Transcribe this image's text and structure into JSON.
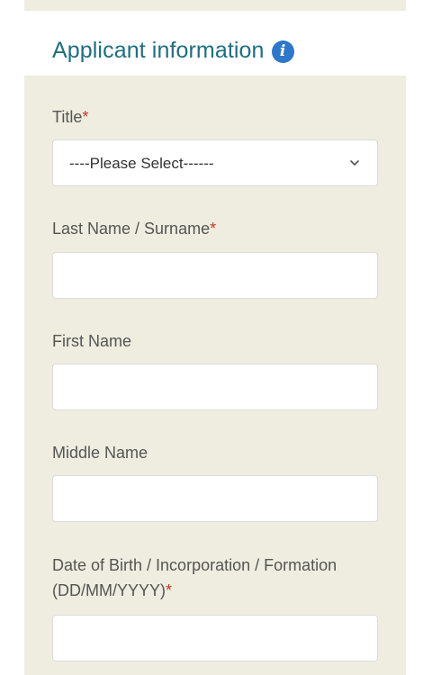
{
  "section": {
    "title": "Applicant information",
    "info_icon": "info-icon"
  },
  "fields": {
    "title": {
      "label": "Title",
      "required_mark": "*",
      "selected": "----Please Select------"
    },
    "last_name": {
      "label": "Last Name / Surname",
      "required_mark": "*",
      "value": ""
    },
    "first_name": {
      "label": "First Name",
      "value": ""
    },
    "middle_name": {
      "label": "Middle Name",
      "value": ""
    },
    "dob": {
      "label_line1": "Date of Birth / Incorporation / Formation",
      "label_line2": "(DD/MM/YYYY)",
      "required_mark": "*",
      "value": ""
    }
  },
  "colors": {
    "panel_bg": "#efede0",
    "title_color": "#1f6e7f",
    "info_icon_bg": "#2f77c8",
    "required_color": "#c0392b"
  }
}
